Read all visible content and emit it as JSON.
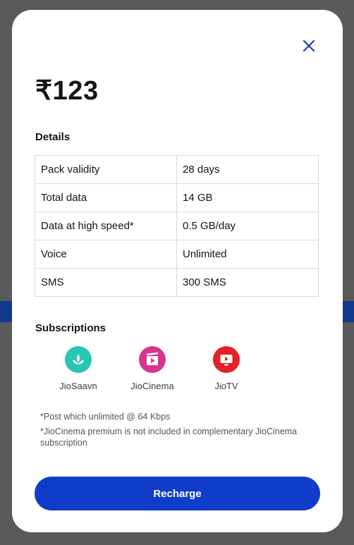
{
  "modal": {
    "price": "₹123",
    "details_title": "Details",
    "details": [
      {
        "label": "Pack validity",
        "value": "28 days"
      },
      {
        "label": "Total data",
        "value": "14 GB"
      },
      {
        "label": "Data at high speed*",
        "value": "0.5 GB/day"
      },
      {
        "label": "Voice",
        "value": "Unlimited"
      },
      {
        "label": "SMS",
        "value": "300 SMS"
      }
    ],
    "subscriptions_title": "Subscriptions",
    "subscriptions": [
      {
        "name": "JioSaavn",
        "icon": "jiosaavn-icon",
        "color": "#2bc5b4"
      },
      {
        "name": "JioCinema",
        "icon": "jiocinema-icon",
        "color": "#d9348d"
      },
      {
        "name": "JioTV",
        "icon": "jiotv-icon",
        "color": "#e32228"
      }
    ],
    "notes": [
      "*Post which unlimited @ 64 Kbps",
      "*JioCinema premium is not included in complementary JioCinema subscription"
    ],
    "recharge_label": "Recharge",
    "accent_color": "#0f3cc9"
  }
}
